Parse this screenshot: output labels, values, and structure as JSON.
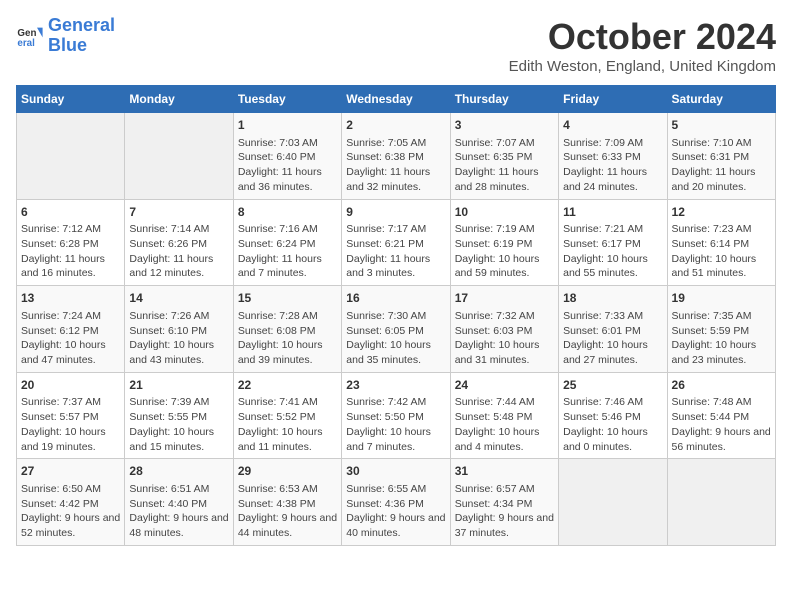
{
  "logo": {
    "line1": "General",
    "line2": "Blue"
  },
  "title": "October 2024",
  "location": "Edith Weston, England, United Kingdom",
  "weekdays": [
    "Sunday",
    "Monday",
    "Tuesday",
    "Wednesday",
    "Thursday",
    "Friday",
    "Saturday"
  ],
  "weeks": [
    [
      {
        "day": "",
        "info": ""
      },
      {
        "day": "",
        "info": ""
      },
      {
        "day": "1",
        "info": "Sunrise: 7:03 AM\nSunset: 6:40 PM\nDaylight: 11 hours and 36 minutes."
      },
      {
        "day": "2",
        "info": "Sunrise: 7:05 AM\nSunset: 6:38 PM\nDaylight: 11 hours and 32 minutes."
      },
      {
        "day": "3",
        "info": "Sunrise: 7:07 AM\nSunset: 6:35 PM\nDaylight: 11 hours and 28 minutes."
      },
      {
        "day": "4",
        "info": "Sunrise: 7:09 AM\nSunset: 6:33 PM\nDaylight: 11 hours and 24 minutes."
      },
      {
        "day": "5",
        "info": "Sunrise: 7:10 AM\nSunset: 6:31 PM\nDaylight: 11 hours and 20 minutes."
      }
    ],
    [
      {
        "day": "6",
        "info": "Sunrise: 7:12 AM\nSunset: 6:28 PM\nDaylight: 11 hours and 16 minutes."
      },
      {
        "day": "7",
        "info": "Sunrise: 7:14 AM\nSunset: 6:26 PM\nDaylight: 11 hours and 12 minutes."
      },
      {
        "day": "8",
        "info": "Sunrise: 7:16 AM\nSunset: 6:24 PM\nDaylight: 11 hours and 7 minutes."
      },
      {
        "day": "9",
        "info": "Sunrise: 7:17 AM\nSunset: 6:21 PM\nDaylight: 11 hours and 3 minutes."
      },
      {
        "day": "10",
        "info": "Sunrise: 7:19 AM\nSunset: 6:19 PM\nDaylight: 10 hours and 59 minutes."
      },
      {
        "day": "11",
        "info": "Sunrise: 7:21 AM\nSunset: 6:17 PM\nDaylight: 10 hours and 55 minutes."
      },
      {
        "day": "12",
        "info": "Sunrise: 7:23 AM\nSunset: 6:14 PM\nDaylight: 10 hours and 51 minutes."
      }
    ],
    [
      {
        "day": "13",
        "info": "Sunrise: 7:24 AM\nSunset: 6:12 PM\nDaylight: 10 hours and 47 minutes."
      },
      {
        "day": "14",
        "info": "Sunrise: 7:26 AM\nSunset: 6:10 PM\nDaylight: 10 hours and 43 minutes."
      },
      {
        "day": "15",
        "info": "Sunrise: 7:28 AM\nSunset: 6:08 PM\nDaylight: 10 hours and 39 minutes."
      },
      {
        "day": "16",
        "info": "Sunrise: 7:30 AM\nSunset: 6:05 PM\nDaylight: 10 hours and 35 minutes."
      },
      {
        "day": "17",
        "info": "Sunrise: 7:32 AM\nSunset: 6:03 PM\nDaylight: 10 hours and 31 minutes."
      },
      {
        "day": "18",
        "info": "Sunrise: 7:33 AM\nSunset: 6:01 PM\nDaylight: 10 hours and 27 minutes."
      },
      {
        "day": "19",
        "info": "Sunrise: 7:35 AM\nSunset: 5:59 PM\nDaylight: 10 hours and 23 minutes."
      }
    ],
    [
      {
        "day": "20",
        "info": "Sunrise: 7:37 AM\nSunset: 5:57 PM\nDaylight: 10 hours and 19 minutes."
      },
      {
        "day": "21",
        "info": "Sunrise: 7:39 AM\nSunset: 5:55 PM\nDaylight: 10 hours and 15 minutes."
      },
      {
        "day": "22",
        "info": "Sunrise: 7:41 AM\nSunset: 5:52 PM\nDaylight: 10 hours and 11 minutes."
      },
      {
        "day": "23",
        "info": "Sunrise: 7:42 AM\nSunset: 5:50 PM\nDaylight: 10 hours and 7 minutes."
      },
      {
        "day": "24",
        "info": "Sunrise: 7:44 AM\nSunset: 5:48 PM\nDaylight: 10 hours and 4 minutes."
      },
      {
        "day": "25",
        "info": "Sunrise: 7:46 AM\nSunset: 5:46 PM\nDaylight: 10 hours and 0 minutes."
      },
      {
        "day": "26",
        "info": "Sunrise: 7:48 AM\nSunset: 5:44 PM\nDaylight: 9 hours and 56 minutes."
      }
    ],
    [
      {
        "day": "27",
        "info": "Sunrise: 6:50 AM\nSunset: 4:42 PM\nDaylight: 9 hours and 52 minutes."
      },
      {
        "day": "28",
        "info": "Sunrise: 6:51 AM\nSunset: 4:40 PM\nDaylight: 9 hours and 48 minutes."
      },
      {
        "day": "29",
        "info": "Sunrise: 6:53 AM\nSunset: 4:38 PM\nDaylight: 9 hours and 44 minutes."
      },
      {
        "day": "30",
        "info": "Sunrise: 6:55 AM\nSunset: 4:36 PM\nDaylight: 9 hours and 40 minutes."
      },
      {
        "day": "31",
        "info": "Sunrise: 6:57 AM\nSunset: 4:34 PM\nDaylight: 9 hours and 37 minutes."
      },
      {
        "day": "",
        "info": ""
      },
      {
        "day": "",
        "info": ""
      }
    ]
  ]
}
